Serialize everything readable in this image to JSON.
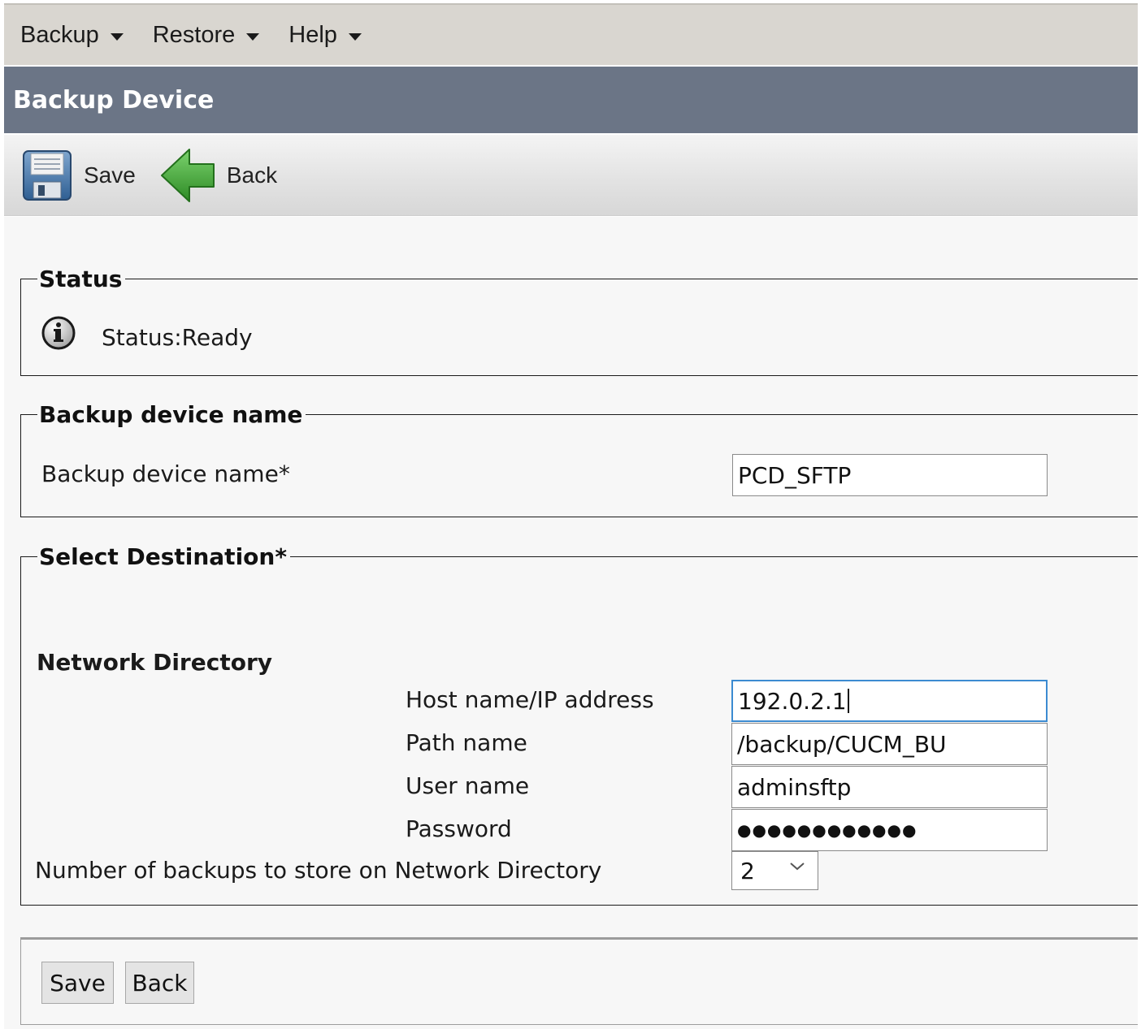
{
  "menu": {
    "items": [
      {
        "label": "Backup"
      },
      {
        "label": "Restore"
      },
      {
        "label": "Help"
      }
    ]
  },
  "title": "Backup Device",
  "toolbar": {
    "save_label": "Save",
    "back_label": "Back"
  },
  "status_group": {
    "legend": "Status",
    "text": "Status:Ready"
  },
  "device_group": {
    "legend": "Backup device name",
    "field_label": "Backup device name*",
    "field_value": "PCD_SFTP"
  },
  "destination_group": {
    "legend": "Select Destination*",
    "section_title": "Network Directory",
    "host_label": "Host name/IP address",
    "host_value": "192.0.2.1",
    "path_label": "Path name",
    "path_value": "/backup/CUCM_BU",
    "user_label": "User name",
    "user_value": "adminsftp",
    "password_label": "Password",
    "password_value": "●●●●●●●●●●●●",
    "count_label": "Number of backups to store on Network Directory",
    "count_value": "2"
  },
  "bottom": {
    "save_label": "Save",
    "back_label": "Back"
  },
  "colors": {
    "title_bar": "#6b7586",
    "menu_bar": "#d9d6d0",
    "back_arrow": "#3fa535",
    "focus_border": "#3c8bd1"
  }
}
